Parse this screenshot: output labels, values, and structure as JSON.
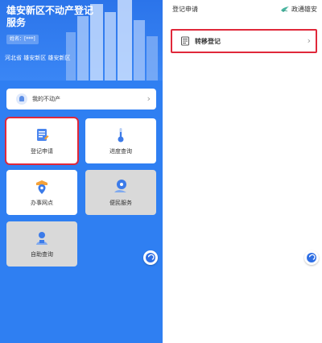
{
  "left": {
    "title": "雄安新区不动产登记服务",
    "name_chip": "姓名：[***]",
    "region": "河北省  雄安新区  雄安新区",
    "my_estate": "我的不动产",
    "tiles": {
      "register": "登记申请",
      "progress": "进度查询",
      "office": "办事网点",
      "convenience": "便民服务",
      "self_query": "自助查询"
    }
  },
  "right": {
    "header_title": "登记申请",
    "brand": "政通雄安",
    "transfer": "转移登记"
  },
  "colors": {
    "primary": "#2f7ff2",
    "highlight": "#e0283a",
    "tile_grey": "#d9d9d9"
  },
  "icons": [
    "user-icon",
    "form-icon",
    "thermometer-icon",
    "location-pin-icon",
    "service-icon",
    "self-query-icon",
    "doc-icon",
    "back-arrow-icon",
    "chevron-right-icon",
    "brand-bird-icon"
  ]
}
